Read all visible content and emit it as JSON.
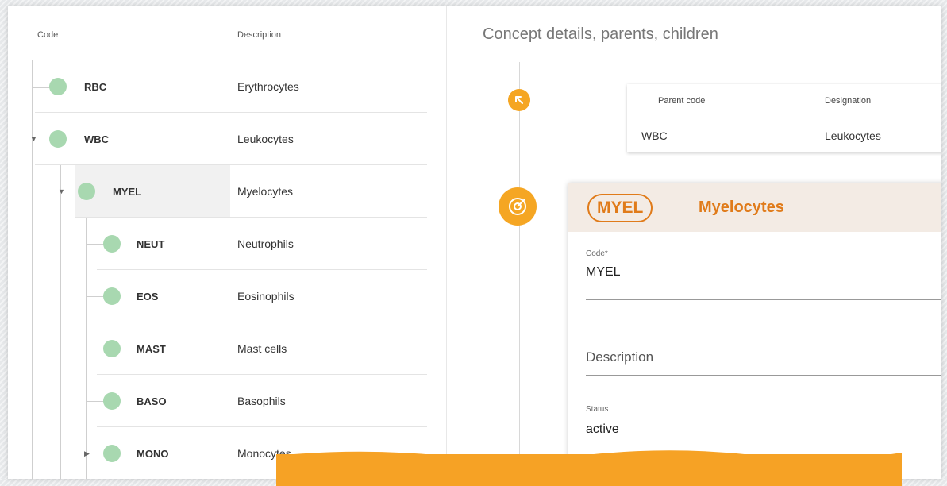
{
  "tree": {
    "header_code": "Code",
    "header_description": "Description",
    "rows": [
      {
        "code": "RBC",
        "description": "Erythrocytes",
        "caret": ""
      },
      {
        "code": "WBC",
        "description": "Leukocytes",
        "caret": "▼"
      },
      {
        "code": "MYEL",
        "description": "Myelocytes",
        "caret": "▼"
      },
      {
        "code": "NEUT",
        "description": "Neutrophils",
        "caret": ""
      },
      {
        "code": "EOS",
        "description": "Eosinophils",
        "caret": ""
      },
      {
        "code": "MAST",
        "description": "Mast cells",
        "caret": ""
      },
      {
        "code": "BASO",
        "description": "Basophils",
        "caret": ""
      },
      {
        "code": "MONO",
        "description": "Monocytes",
        "caret": "▶"
      }
    ]
  },
  "details": {
    "title": "Concept details, parents, children",
    "parent_table": {
      "col_code": "Parent code",
      "col_designation": "Designation",
      "row_code": "WBC",
      "row_designation": "Leukocytes"
    },
    "concept": {
      "badge_code": "MYEL",
      "name": "Myelocytes",
      "code_label": "Code*",
      "code_value": "MYEL",
      "description_placeholder": "Description",
      "status_label": "Status",
      "status_value": "active"
    }
  },
  "icons": {
    "parent_icon": "arrow-up-left-icon",
    "concept_icon": "target-icon"
  },
  "colors": {
    "accent": "#e07b1a",
    "timeline_icon": "#f5a623",
    "node_dot": "#a8d8b0",
    "banner": "#f6a225"
  }
}
